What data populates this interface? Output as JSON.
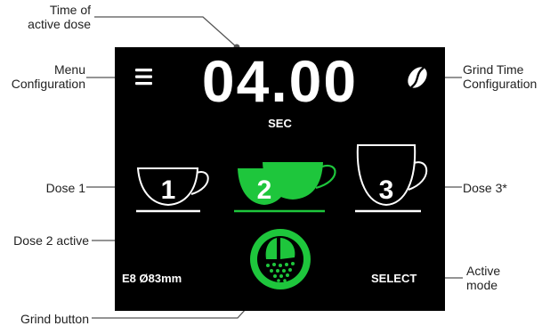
{
  "screen": {
    "time_value": "04.00",
    "time_unit": "SEC",
    "burr_info": "E8  Ø83mm",
    "mode": "SELECT",
    "doses": [
      {
        "number": "1",
        "active": false
      },
      {
        "number": "2",
        "active": true
      },
      {
        "number": "3",
        "active": false
      }
    ],
    "icons": {
      "menu": "hamburger-menu-icon",
      "grind_time": "coffee-bean-icon",
      "grind": "grind-button-icon"
    }
  },
  "callouts": {
    "time_of_active_dose": "Time of\nactive dose",
    "menu_configuration": "Menu\nConfiguration",
    "grind_time_configuration": "Grind Time\nConfiguration",
    "dose_1": "Dose 1",
    "dose_3": "Dose 3*",
    "dose_2_active": "Dose 2 active",
    "active_mode": "Active\nmode",
    "grind_button": "Grind button"
  },
  "colors": {
    "screen_background": "#000000",
    "accent_green": "#1ec63c",
    "foreground_white": "#ffffff",
    "callout_line": "#555555"
  }
}
